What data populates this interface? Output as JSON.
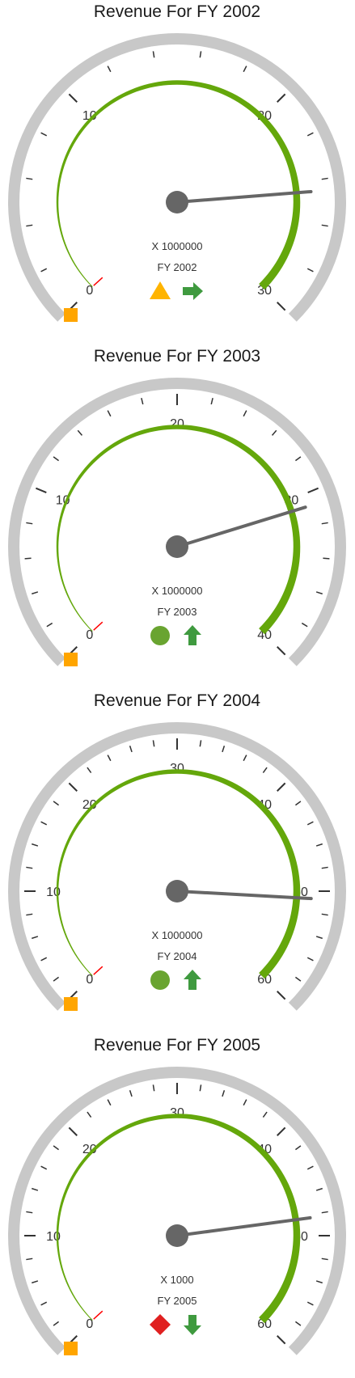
{
  "chart_data": [
    {
      "type": "gauge",
      "title": "Revenue For FY 2002",
      "scale_min": 0,
      "scale_max": 30,
      "major_ticks": [
        0,
        10,
        20,
        30
      ],
      "minor_tick_step": 2,
      "needle_value": 24.5,
      "range": {
        "from": 0,
        "to": 30
      },
      "multiplier_text": "X 1000000",
      "fy_text": "FY 2002",
      "indicators": [
        "warning-triangle",
        "right-arrow"
      ]
    },
    {
      "type": "gauge",
      "title": "Revenue For FY 2003",
      "scale_min": 0,
      "scale_max": 40,
      "major_ticks": [
        0,
        10,
        20,
        30,
        40
      ],
      "minor_tick_step": 2,
      "needle_value": 30.8,
      "range": {
        "from": 0,
        "to": 40
      },
      "multiplier_text": "X 1000000",
      "fy_text": "FY 2003",
      "indicators": [
        "green-circle",
        "up-arrow"
      ]
    },
    {
      "type": "gauge",
      "title": "Revenue For FY 2004",
      "scale_min": 0,
      "scale_max": 60,
      "major_ticks": [
        0,
        10,
        20,
        30,
        40,
        50,
        60
      ],
      "minor_tick_step": 2,
      "needle_value": 50.7,
      "range": {
        "from": 0,
        "to": 60
      },
      "multiplier_text": "X 1000000",
      "fy_text": "FY 2004",
      "indicators": [
        "green-circle",
        "up-arrow"
      ]
    },
    {
      "type": "gauge",
      "title": "Revenue For FY 2005",
      "scale_min": 0,
      "scale_max": 60,
      "major_ticks": [
        0,
        10,
        20,
        30,
        40,
        50,
        60
      ],
      "minor_tick_step": 2,
      "needle_value": 48.3,
      "range": {
        "from": 0,
        "to": 60
      },
      "multiplier_text": "X 1000",
      "fy_text": "FY 2005",
      "indicators": [
        "red-diamond",
        "down-arrow"
      ]
    }
  ],
  "colors": {
    "outer_rim": "#c8c8c8",
    "range": "#64a70b",
    "needle": "#666666",
    "tick": "#333333",
    "marker_square": "#ffa500",
    "start_marker": "#ff0000",
    "warning": "#ffb400",
    "arrow": "#3f9a3f",
    "circle": "#69a430",
    "diamond": "#e02020"
  }
}
